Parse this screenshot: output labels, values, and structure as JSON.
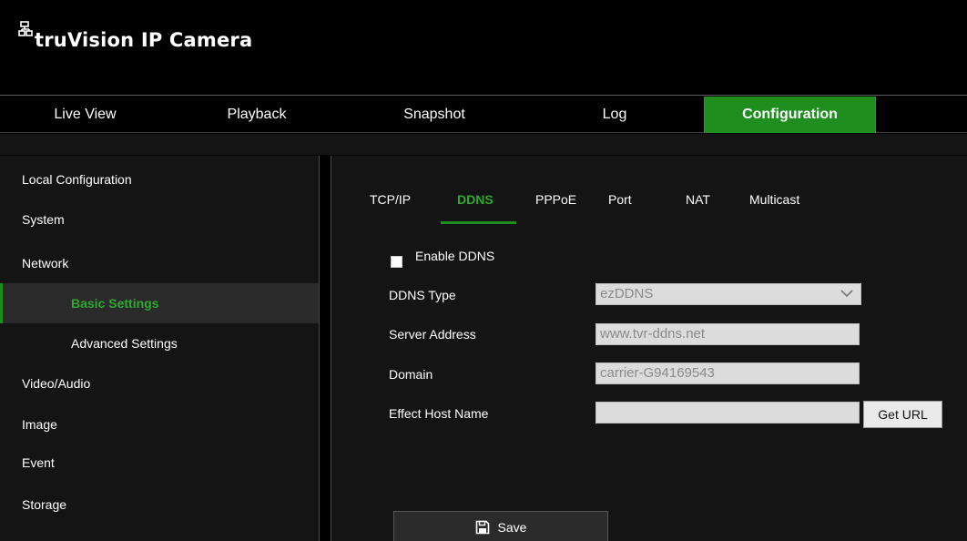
{
  "app": {
    "title": "truVision  IP Camera"
  },
  "nav": {
    "items": [
      {
        "label": "Live View"
      },
      {
        "label": "Playback"
      },
      {
        "label": "Snapshot"
      },
      {
        "label": "Log"
      },
      {
        "label": "Configuration"
      }
    ],
    "active": "Configuration"
  },
  "sidebar": {
    "items": [
      {
        "label": "Local Configuration"
      },
      {
        "label": "System"
      },
      {
        "label": "Network"
      },
      {
        "label": "Basic Settings"
      },
      {
        "label": "Advanced Settings"
      },
      {
        "label": "Video/Audio"
      },
      {
        "label": "Image"
      },
      {
        "label": "Event"
      },
      {
        "label": "Storage"
      }
    ],
    "active": "Basic Settings"
  },
  "tabs": {
    "items": [
      {
        "label": "TCP/IP"
      },
      {
        "label": "DDNS"
      },
      {
        "label": "PPPoE"
      },
      {
        "label": "Port"
      },
      {
        "label": "NAT"
      },
      {
        "label": "Multicast"
      }
    ],
    "active": "DDNS"
  },
  "form": {
    "enable_ddns": {
      "label": "Enable DDNS",
      "checked": false
    },
    "ddns_type": {
      "label": "DDNS Type",
      "value": "ezDDNS"
    },
    "server_address": {
      "label": "Server Address",
      "value": "www.tvr-ddns.net"
    },
    "domain": {
      "label": "Domain",
      "value": "carrier-G94169543"
    },
    "effect_host_name": {
      "label": "Effect Host Name",
      "value": ""
    },
    "get_url_label": "Get URL",
    "save_label": "Save"
  },
  "colors": {
    "accent": "#1e8e1e",
    "accent_text": "#2ea82e",
    "background": "#000000",
    "panel": "#141414"
  },
  "icons": {
    "logo": "network-logo-icon",
    "save": "floppy-disk-icon",
    "dropdown": "chevron-down-icon"
  }
}
